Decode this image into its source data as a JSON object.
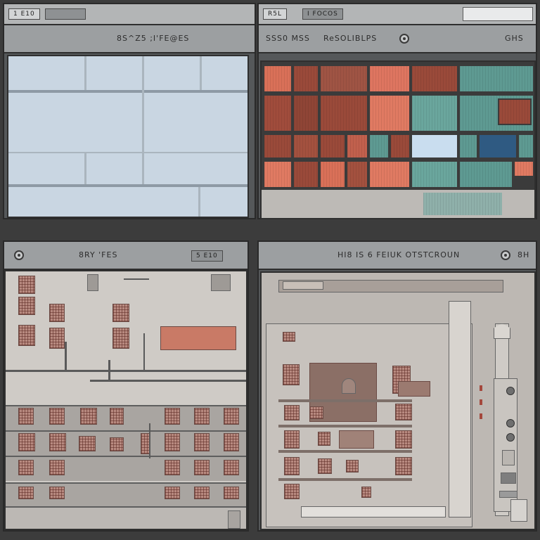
{
  "window": {
    "background": "#3c3c3c"
  },
  "panels": {
    "top_left": {
      "chip_label": "1 E10",
      "chip2_label": "",
      "title": "8S^Z5 ;I'FE@ES"
    },
    "top_right": {
      "chip_label": "R5L",
      "chip2_label": "I FOCOS",
      "title_left": "SSS0 MSS",
      "title_mid": "ReSOLIBLPS",
      "title_right": "GHS"
    },
    "bottom_left": {
      "title": "8RY 'FES",
      "chip_label": "5 E10"
    },
    "bottom_right": {
      "title": "HI8 IS 6 FEIUK OTSTCROUN",
      "title_right": "8H"
    }
  },
  "colors": {
    "sky": "#c9d6e2",
    "brick": "#9a4a3a",
    "salmon": "#d97058",
    "teal": "#5e9a92",
    "navy": "#2f5a82"
  }
}
